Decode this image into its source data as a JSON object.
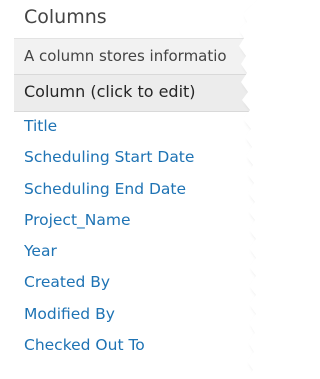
{
  "section": {
    "title": "Columns",
    "description": "A column stores informatio"
  },
  "column_table": {
    "header": "Column (click to edit)",
    "items": [
      {
        "label": "Title"
      },
      {
        "label": "Scheduling Start Date"
      },
      {
        "label": "Scheduling End Date"
      },
      {
        "label": "Project_Name"
      },
      {
        "label": "Year"
      },
      {
        "label": "Created By"
      },
      {
        "label": "Modified By"
      },
      {
        "label": "Checked Out To"
      }
    ]
  },
  "colors": {
    "link": "#1e73b4",
    "title_text": "#444444",
    "header_band": "#ececec"
  }
}
